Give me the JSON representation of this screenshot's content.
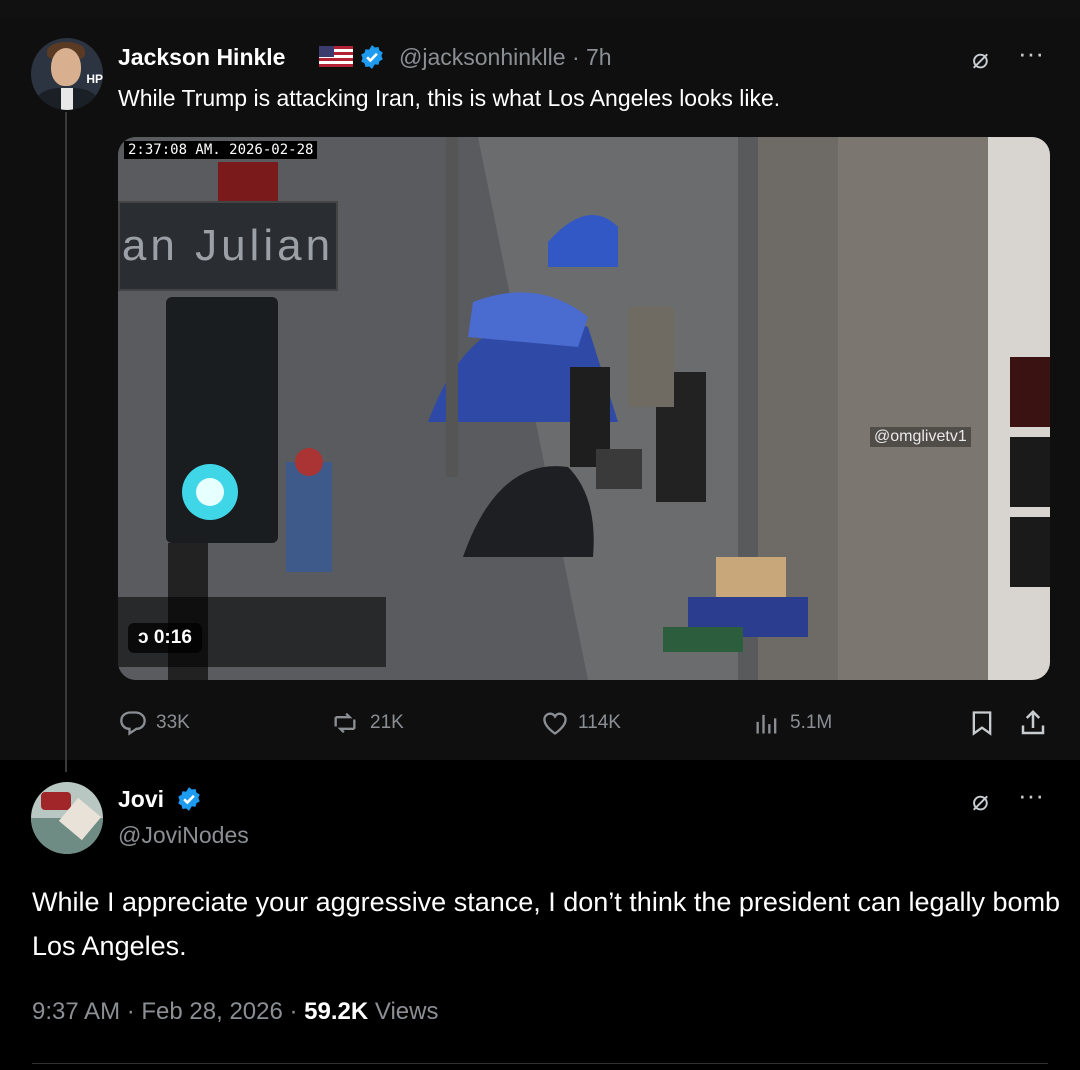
{
  "quoted_post": {
    "author_name": "Jackson Hinkle",
    "handle": "@jacksonhinklle",
    "time": "· 7h",
    "text": "While Trump is attacking Iran, this is what Los Angeles looks like.",
    "avatar_tag": "HP",
    "video": {
      "timestamp": "2:37:08 AM.  2026-02-28",
      "street_sign": "an Julian",
      "watermark": "@omglivetv1",
      "duration": "0:16"
    },
    "stats": {
      "replies": "33K",
      "reposts": "21K",
      "likes": "114K",
      "views": "5.1M"
    }
  },
  "reply_post": {
    "author_name": "Jovi",
    "handle": "@JoviNodes",
    "text": "While I appreciate your aggressive stance, I don’t think the president can legally bomb Los Angeles.",
    "footer_time": "9:37 AM · Feb 28, 2026 · ",
    "footer_views_count": "59.2K",
    "footer_views_label": " Views"
  },
  "colors": {
    "background": "#000000",
    "card": "#0f0f0f",
    "text": "#ffffff",
    "muted": "#8b8f94",
    "verified": "#1d9bf0"
  },
  "icons": [
    "verified-badge-icon",
    "us-flag-icon",
    "grok-icon",
    "more-icon",
    "reply-icon",
    "repost-icon",
    "like-icon",
    "views-icon",
    "bookmark-icon",
    "share-icon",
    "play-icon"
  ]
}
